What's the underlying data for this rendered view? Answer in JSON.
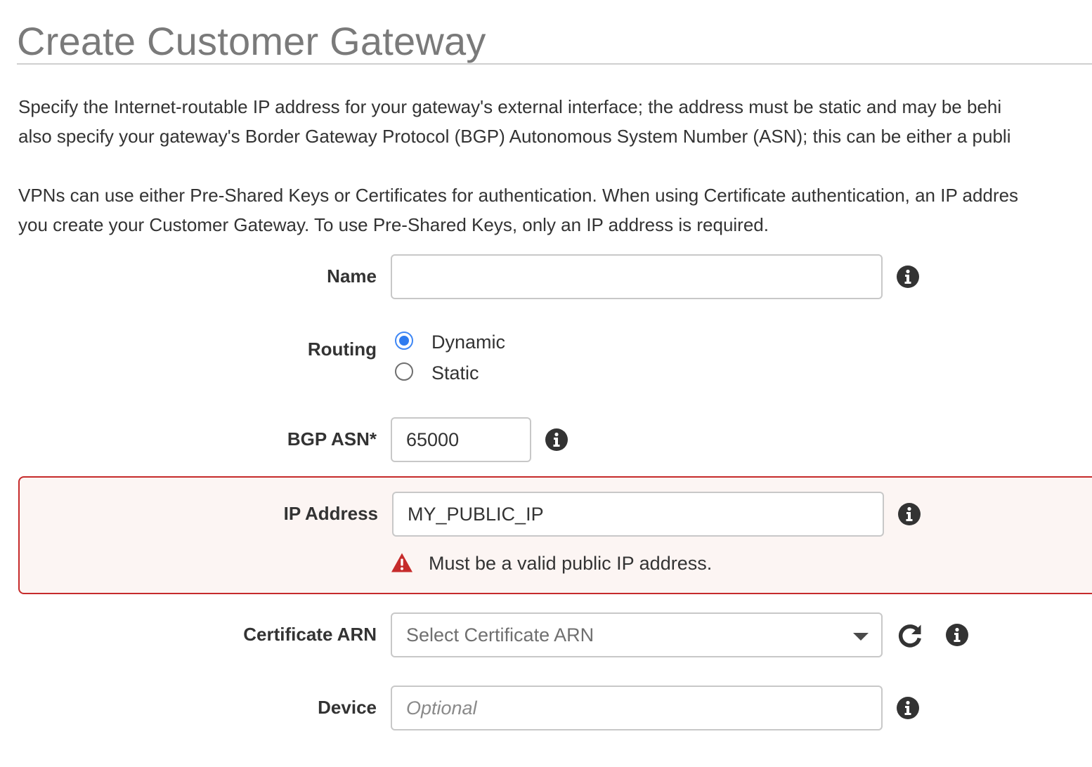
{
  "page": {
    "title": "Create Customer Gateway",
    "intro_line1": "Specify the Internet-routable IP address for your gateway's external interface; the address must be static and may be behi",
    "intro_line2": "also specify your gateway's Border Gateway Protocol (BGP) Autonomous System Number (ASN); this can be either a publi",
    "auth_line1": "VPNs can use either Pre-Shared Keys or Certificates for authentication. When using Certificate authentication, an IP addres",
    "auth_line2": "you create your Customer Gateway. To use Pre-Shared Keys, only an IP address is required."
  },
  "form": {
    "name": {
      "label": "Name",
      "value": "",
      "info_icon": "info-circle-icon"
    },
    "routing": {
      "label": "Routing",
      "options": [
        "Dynamic",
        "Static"
      ],
      "selected": "Dynamic"
    },
    "bgp_asn": {
      "label": "BGP ASN*",
      "value": "65000",
      "info_icon": "info-circle-icon"
    },
    "ip_address": {
      "label": "IP Address",
      "value": "MY_PUBLIC_IP",
      "error": "Must be a valid public IP address.",
      "error_icon": "warning-triangle-icon",
      "info_icon": "info-circle-icon"
    },
    "certificate_arn": {
      "label": "Certificate ARN",
      "placeholder": "Select Certificate ARN",
      "refresh_icon": "refresh-icon",
      "info_icon": "info-circle-icon"
    },
    "device": {
      "label": "Device",
      "placeholder": "Optional",
      "value": "",
      "info_icon": "info-circle-icon"
    }
  },
  "colors": {
    "title": "#7a7a7a",
    "text": "#333333",
    "error_border": "#c62b2b",
    "error_background": "#fcf5f3",
    "radio_selected": "#2e7bf0",
    "icon": "#333333"
  }
}
